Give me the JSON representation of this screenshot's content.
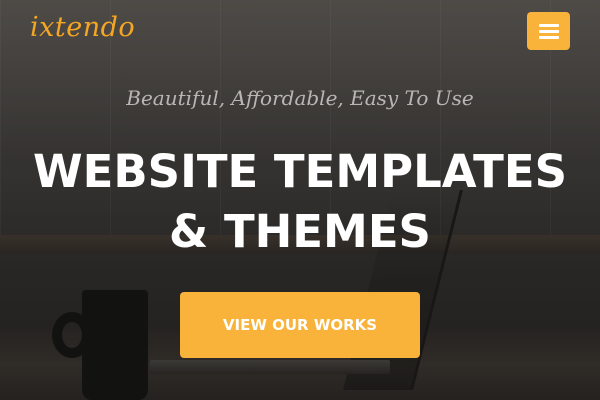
{
  "brand": {
    "logo_text": "ixtendo",
    "accent_color": "#f9b23a"
  },
  "header": {
    "menu_icon": "hamburger-icon"
  },
  "hero": {
    "tagline": "Beautiful, Affordable, Easy To Use",
    "headline_line1": "WEBSITE TEMPLATES",
    "headline_line2": "& THEMES",
    "cta_label": "VIEW OUR WORKS"
  }
}
